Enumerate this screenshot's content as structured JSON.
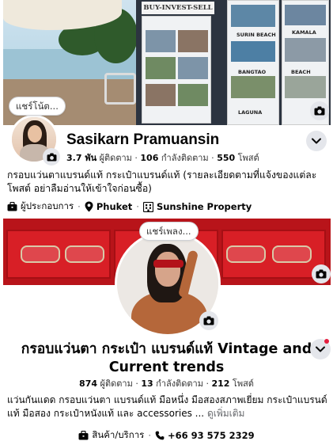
{
  "profile1": {
    "cover": {
      "sign_text": "BUY-INVEST-SELL",
      "poster_labels": [
        "SURIN BEACH",
        "KAMALA",
        "BANGTAO",
        "BEACH",
        "LAGUNA"
      ]
    },
    "note_bubble": "แชร์โน้ต...",
    "name": "Sasikarn Pramuansin",
    "stats": {
      "followers_num": "3.7 พัน",
      "followers_label": " ผู้ติดตาม",
      "following_num": "106",
      "following_label": " กำลังติดตาม",
      "posts_num": "550",
      "posts_label": " โพสต์",
      "sep": " · "
    },
    "bio": "กรอบแว่นตาแบรนด์แท้ กระเป๋าแบรนด์แท้  (รายละเอียดตามที่แจ้งของแต่ละโพสต์ อย่าลืมอ่านให้เข้าใจก่อนซื้อ)",
    "info": {
      "role": "ผู้ประกอบการ",
      "location": "Phuket",
      "workplace": "Sunshine Property"
    }
  },
  "profile2": {
    "note_bubble": "แชร์เพลง...",
    "name": "กรอบแว่นตา กระเป๋า แบรนด์แท้ Vintage and Current trends",
    "stats": {
      "followers_num": "874",
      "followers_label": " ผู้ติดตาม",
      "following_num": "13",
      "following_label": " กำลังติดตาม",
      "posts_num": "212",
      "posts_label": " โพสต์",
      "sep": " · "
    },
    "bio": "แว่นกันแดด กรอบแว่นตา แบรนด์แท้ มือหนึ่ง มือสองสภาพเยี่ยม กระเป๋าแบรนด์แท้ มือสอง กระเป๋าหนังแท้ และ accessories ... ",
    "see_more": "ดูเพิ่มเติม",
    "info": {
      "category": "สินค้า/บริการ",
      "phone": "+66 93 575 2329"
    }
  },
  "icons": {
    "camera": "camera-icon",
    "chevron": "chevron-down-icon",
    "briefcase": "briefcase-icon",
    "pin": "location-pin-icon",
    "building": "building-icon",
    "phone": "phone-icon"
  },
  "colors": {
    "text": "#050505",
    "secondary": "#65676b",
    "button_bg": "#e4e6eb",
    "cover2_red": "#b8141a",
    "notification": "#e41e3f"
  }
}
